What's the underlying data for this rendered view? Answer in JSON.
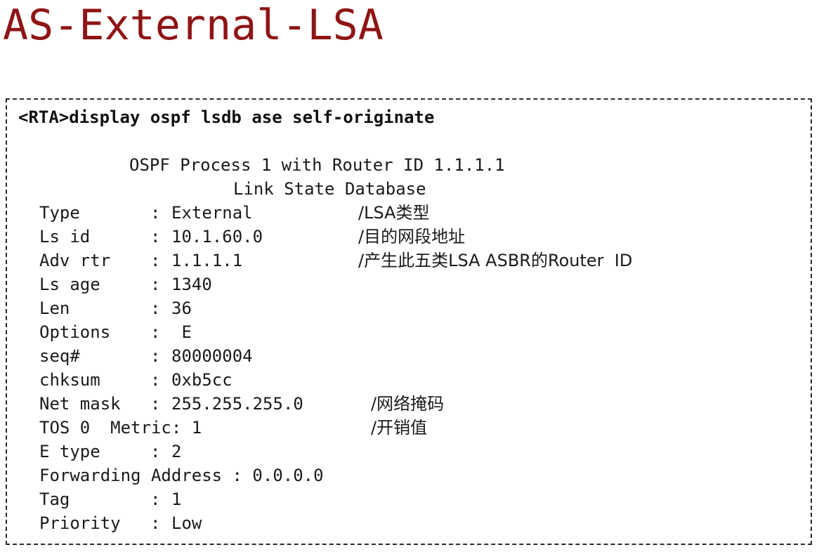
{
  "title": "AS-External-LSA",
  "command": "<RTA>display ospf lsdb ase self-originate",
  "header": {
    "line1": "OSPF Process 1 with Router ID 1.1.1.1",
    "line2": "Link State Database"
  },
  "fields": {
    "type": {
      "label": "Type",
      "value": "External",
      "comment": "/LSA类型"
    },
    "ls_id": {
      "label": "Ls id",
      "value": "10.1.60.0",
      "comment": "/目的网段地址"
    },
    "adv_rtr": {
      "label": "Adv rtr",
      "value": "1.1.1.1",
      "comment": "/产生此五类LSA ASBR的Router  ID"
    },
    "ls_age": {
      "label": "Ls age",
      "value": "1340"
    },
    "len": {
      "label": "Len",
      "value": "36"
    },
    "options": {
      "label": "Options",
      "value": " E"
    },
    "seq": {
      "label": "seq#",
      "value": "80000004"
    },
    "chksum": {
      "label": "chksum",
      "value": "0xb5cc"
    },
    "net_mask": {
      "label": "Net mask",
      "value": "255.255.255.0",
      "comment": "/网络掩码"
    },
    "tos": {
      "text": "TOS 0  Metric: 1",
      "comment": "/开销值"
    },
    "e_type": {
      "label": "E type",
      "value": "2"
    },
    "forwarding": {
      "text": "Forwarding Address : 0.0.0.0"
    },
    "tag": {
      "label": "Tag",
      "value": "1"
    },
    "priority": {
      "label": "Priority",
      "value": "Low"
    }
  },
  "separator": ":",
  "colors": {
    "title": "#8f1414",
    "text": "#1a1a1a",
    "border": "#2a2a2a"
  }
}
